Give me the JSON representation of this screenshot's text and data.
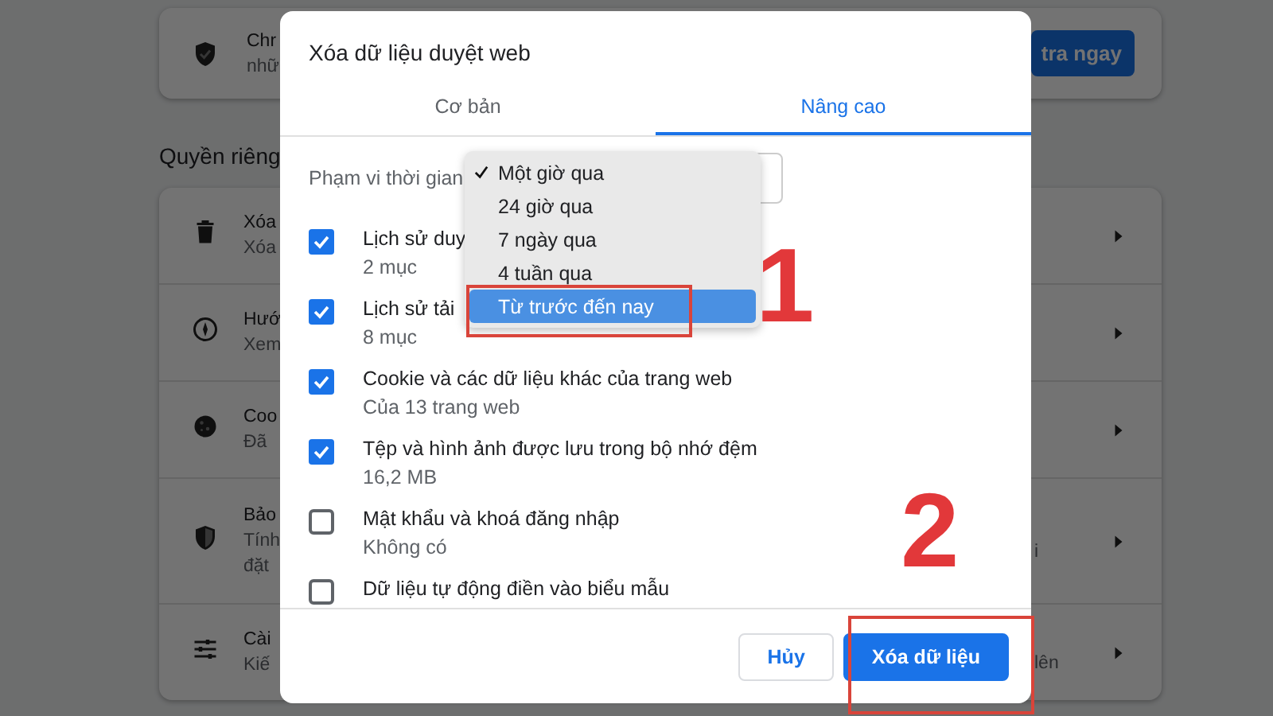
{
  "background_page": {
    "top_card": {
      "lines": [
        "Chr",
        "nhữ"
      ],
      "button": "tra ngay"
    },
    "section_title": "Quyền riêng",
    "rows": [
      {
        "kind": "trash",
        "lines": [
          "Xóa",
          "Xóa"
        ]
      },
      {
        "kind": "compass",
        "lines": [
          "Hướ",
          "Xem"
        ]
      },
      {
        "kind": "cookie",
        "lines": [
          "Coo",
          "Đã"
        ]
      },
      {
        "kind": "shield",
        "lines": [
          "Bảo",
          "Tính",
          "đặt"
        ],
        "tail": "i"
      },
      {
        "kind": "sliders",
        "lines": [
          "Cài",
          "Kiế"
        ],
        "tail": "lên"
      }
    ]
  },
  "dialog": {
    "title": "Xóa dữ liệu duyệt web",
    "tabs": [
      {
        "label": "Cơ bản",
        "selected": false
      },
      {
        "label": "Nâng cao",
        "selected": true
      }
    ],
    "time_range": {
      "label": "Phạm vi thời gian",
      "options": [
        {
          "label": "Một giờ qua",
          "selected": true,
          "highlighted": false
        },
        {
          "label": "24 giờ qua",
          "selected": false,
          "highlighted": false
        },
        {
          "label": "7 ngày qua",
          "selected": false,
          "highlighted": false
        },
        {
          "label": "4 tuần qua",
          "selected": false,
          "highlighted": false
        },
        {
          "label": "Từ trước đến nay",
          "selected": false,
          "highlighted": true
        }
      ]
    },
    "items": [
      {
        "label": "Lịch sử duy",
        "detail": "2 mục",
        "checked": true
      },
      {
        "label": "Lịch sử tải",
        "detail": "8 mục",
        "checked": true
      },
      {
        "label": "Cookie và các dữ liệu khác của trang web",
        "detail": "Của 13 trang web",
        "checked": true
      },
      {
        "label": "Tệp và hình ảnh được lưu trong bộ nhớ đệm",
        "detail": "16,2 MB",
        "checked": true
      },
      {
        "label": "Mật khẩu và khoá đăng nhập",
        "detail": "Không có",
        "checked": false
      },
      {
        "label": "Dữ liệu tự động điền vào biểu mẫu",
        "checked": false
      }
    ],
    "buttons": [
      {
        "label": "Hủy",
        "kind": "secondary"
      },
      {
        "label": "Xóa dữ liệu",
        "kind": "primary"
      }
    ]
  },
  "annotations": [
    "1",
    "2"
  ]
}
